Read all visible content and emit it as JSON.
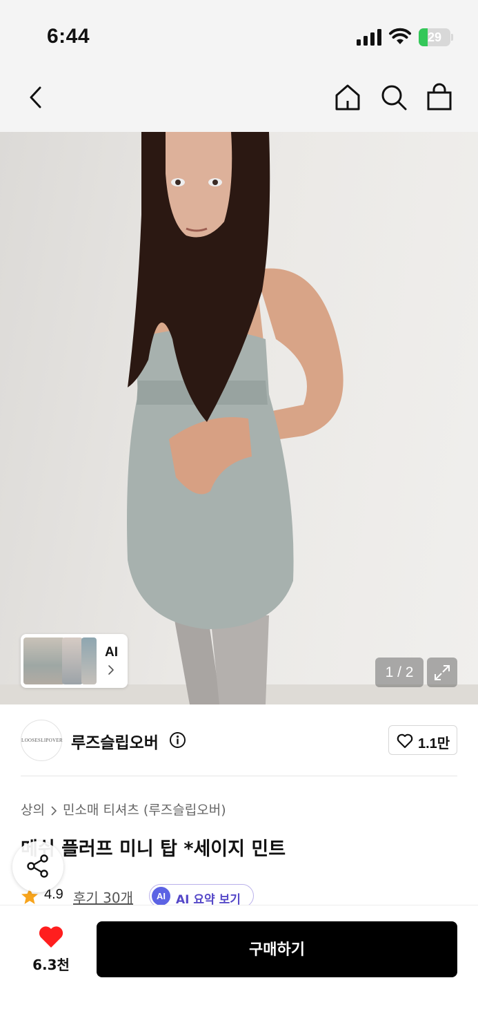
{
  "status_bar": {
    "time": "6:44",
    "battery_level": "29",
    "battery_fraction": 0.29,
    "icons": [
      "cellular-signal-icon",
      "wifi-icon",
      "battery-icon"
    ]
  },
  "nav": {
    "icons": [
      "back-arrow-icon",
      "home-icon",
      "search-icon",
      "shopping-bag-icon"
    ]
  },
  "gallery": {
    "ai_label": "AI",
    "page_counter": "1 / 2",
    "expand_icon": "expand-icon"
  },
  "brand": {
    "logo_text": "LOOSESLIPOVER",
    "name": "루즈슬립오버",
    "like_count": "1.1만"
  },
  "product": {
    "breadcrumb_category": "상의",
    "breadcrumb_subcategory": "민소매 티셔츠 (루즈슬립오버)",
    "title": "메쉬 플러프 미니 탑 *세이지 민트",
    "rating": "4.9",
    "reviews": "후기 30개",
    "ai_badge": "AI",
    "ai_summary": "AI 요약 보기"
  },
  "bottom_bar": {
    "like_count": "6.3천",
    "buy_label": "구매하기"
  },
  "colors": {
    "accent_red": "#ff1e1e",
    "ai_purple": "#5c63e4",
    "battery_green": "#34c759",
    "star_orange": "#f7a41d"
  }
}
